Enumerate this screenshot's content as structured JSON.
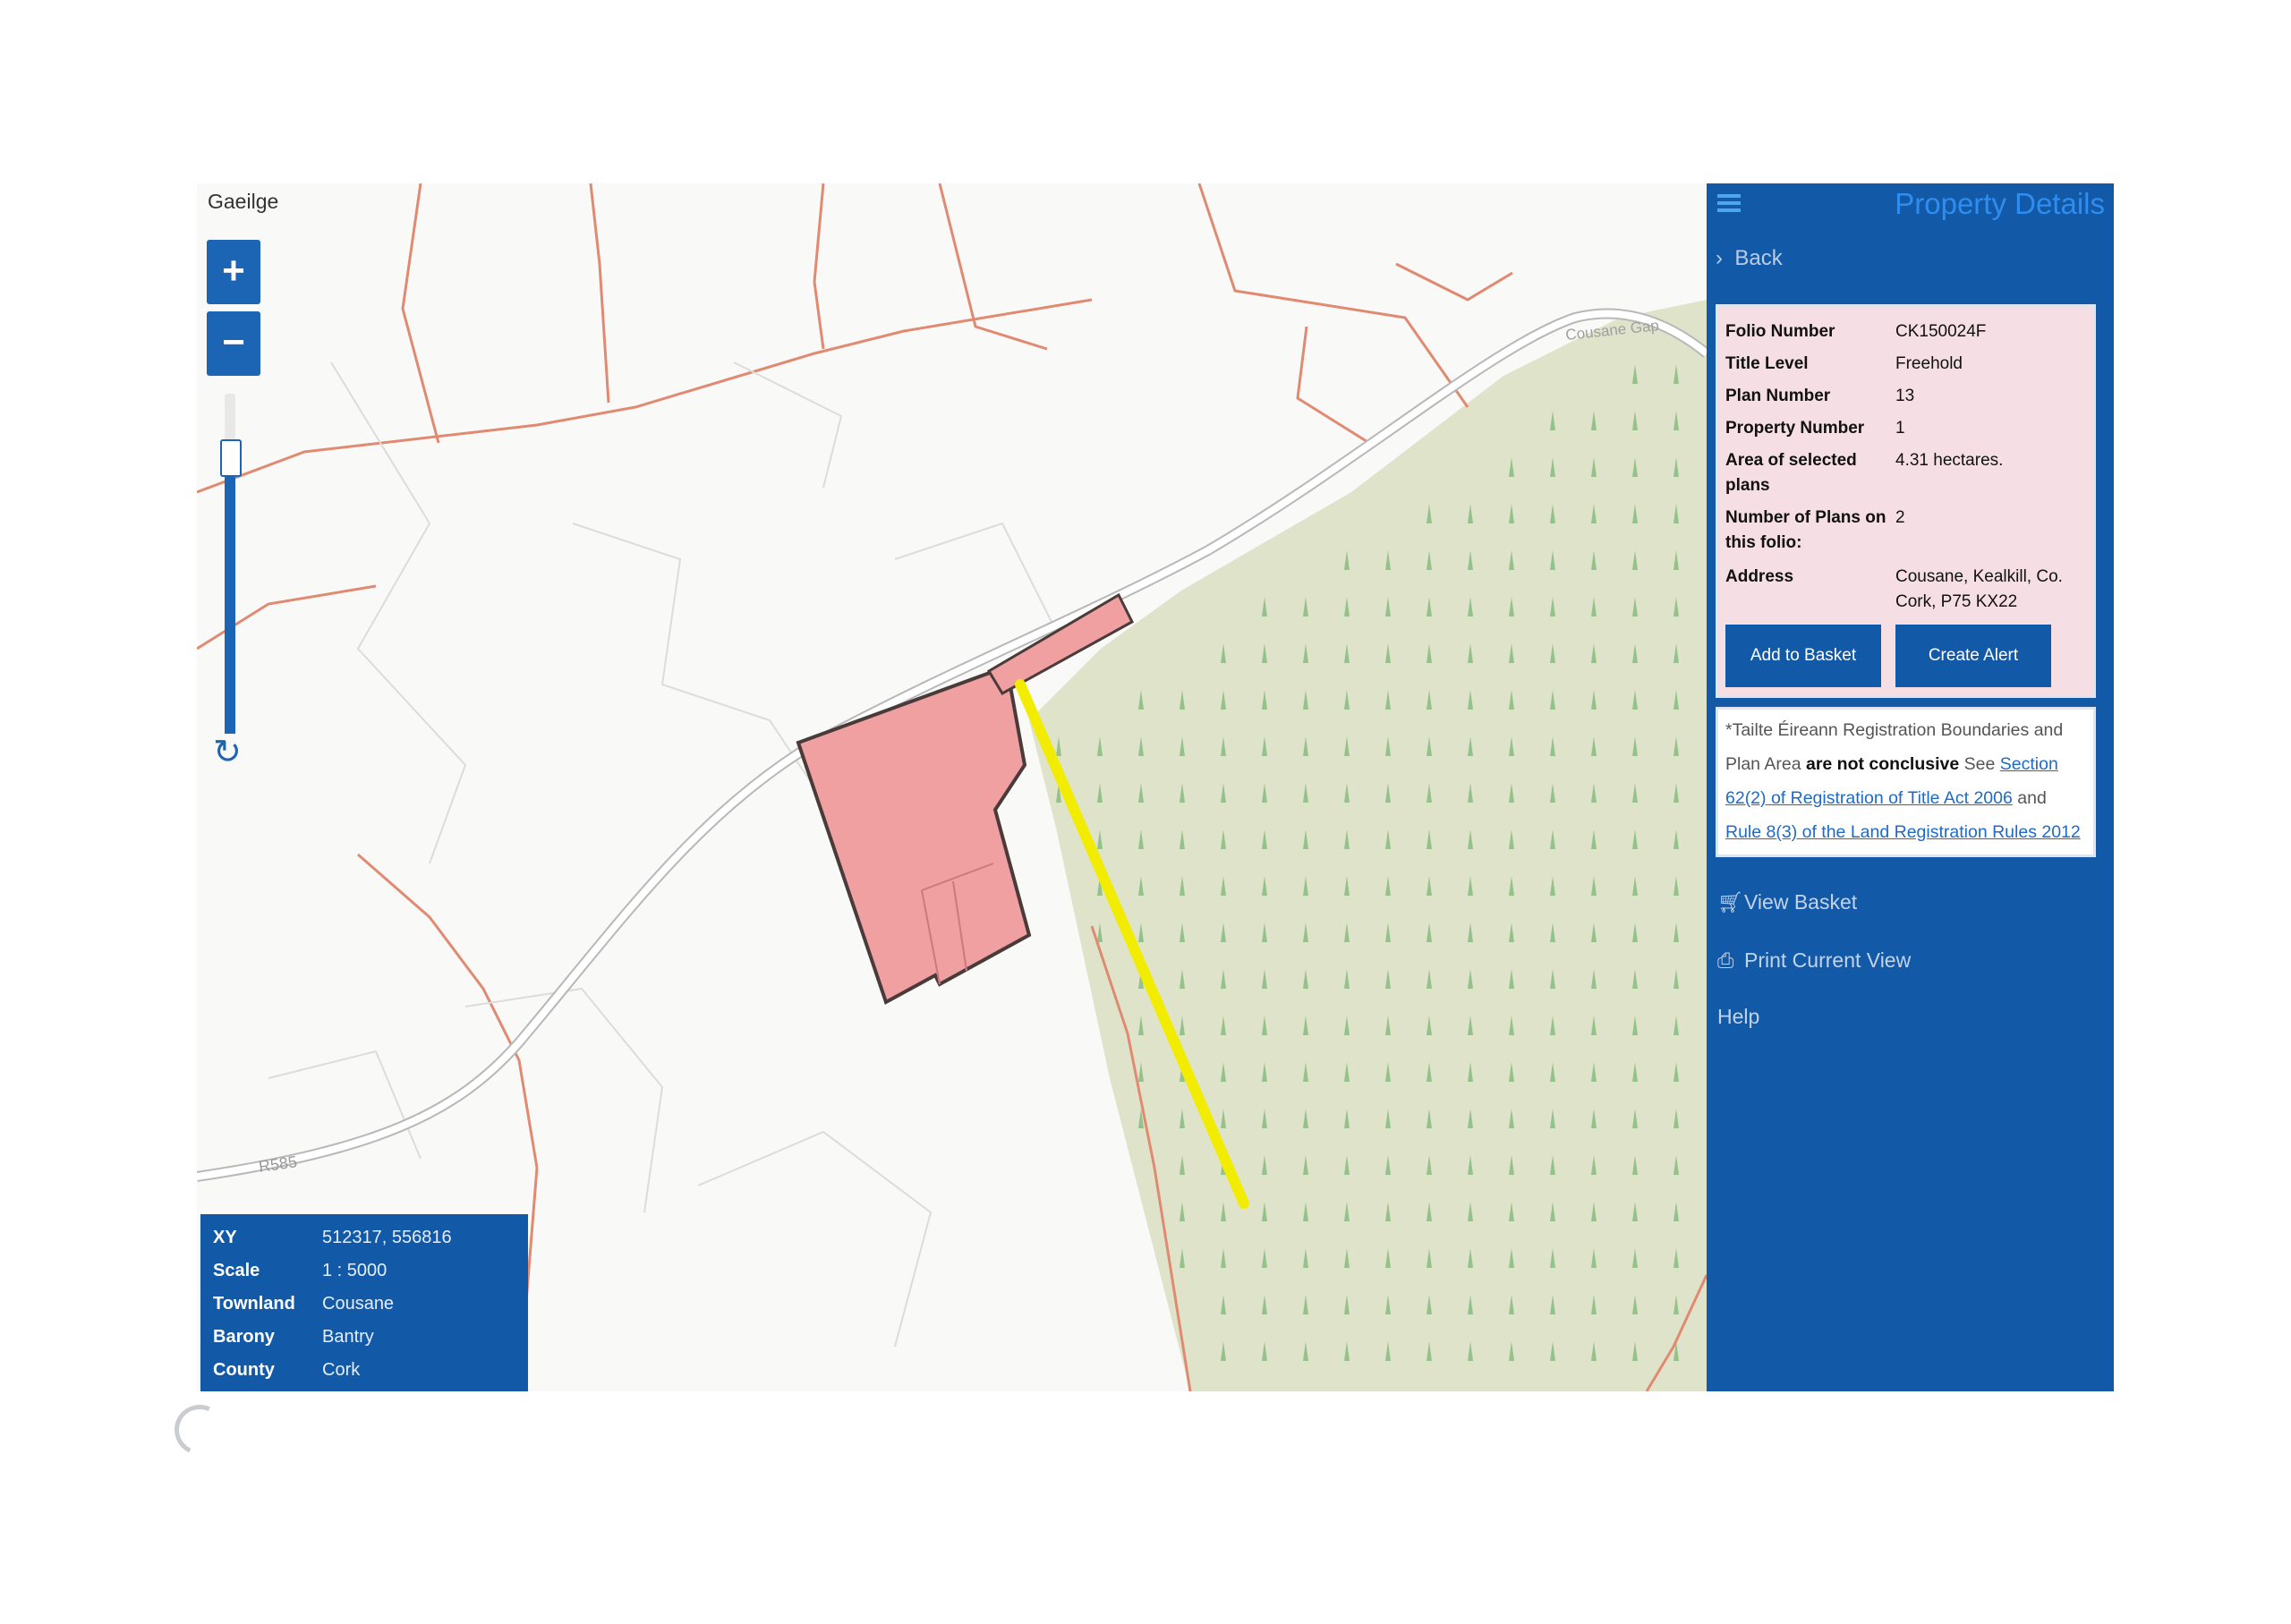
{
  "map": {
    "language_toggle": "Gaeilge",
    "zoom_in_label": "+",
    "zoom_out_label": "−",
    "zoom_level": 0.85,
    "road_labels": [
      "R585",
      "Cousane Gap"
    ],
    "colors": {
      "parcel_fill": "#f0a0a0",
      "parcel_stroke": "#4a3b3b",
      "road": "#c8c8c8",
      "boundary": "#e08a72",
      "forest": "#dfe3ca",
      "tree": "#94c28a",
      "highlight_line": "#f2ec00"
    }
  },
  "info_box": {
    "rows": [
      {
        "label": "XY",
        "value": "512317, 556816"
      },
      {
        "label": "Scale",
        "value": "1 : 5000"
      },
      {
        "label": "Townland",
        "value": "Cousane"
      },
      {
        "label": "Barony",
        "value": "Bantry"
      },
      {
        "label": "County",
        "value": "Cork"
      }
    ]
  },
  "panel": {
    "menu_icon": "hamburger-icon",
    "title": "Property Details",
    "back_label": "Back",
    "details": [
      {
        "label": "Folio Number",
        "value": "CK150024F"
      },
      {
        "label": "Title Level",
        "value": "Freehold"
      },
      {
        "label": "Plan Number",
        "value": "13"
      },
      {
        "label": "Property Number",
        "value": "1"
      },
      {
        "label": "Area of selected plans",
        "value": "4.31 hectares."
      },
      {
        "label": "Number of Plans on this folio:",
        "value": "2"
      },
      {
        "label": "Address",
        "value": "Cousane, Kealkill, Co. Cork, P75 KX22"
      }
    ],
    "add_basket_label": "Add to Basket",
    "create_alert_label": "Create Alert",
    "notice": {
      "intro": "*Tailte Éireann Registration Boundaries and Plan Area",
      "bold": "are not conclusive",
      "see": "See",
      "link1": "Section 62(2) of Registration of Title Act 2006",
      "and": "and",
      "link2": "Rule 8(3) of the Land Registration Rules 2012"
    },
    "menu": {
      "view_basket": "View Basket",
      "print_view": "Print Current View",
      "help": "Help"
    }
  }
}
